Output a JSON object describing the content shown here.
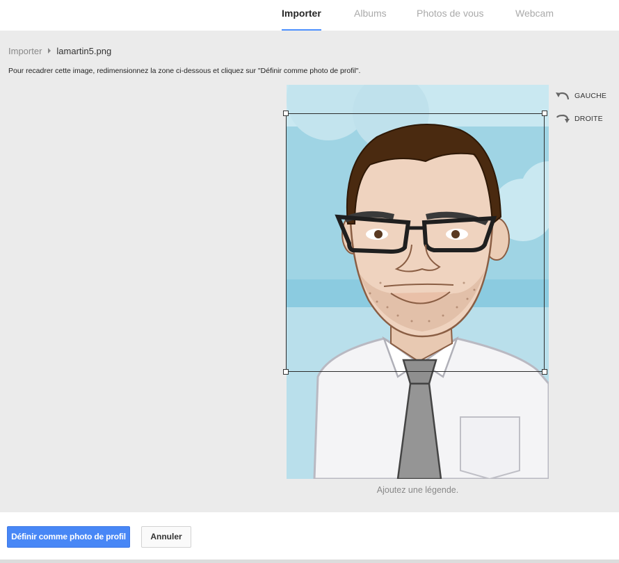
{
  "tabs": [
    {
      "label": "Importer",
      "active": true
    },
    {
      "label": "Albums",
      "active": false
    },
    {
      "label": "Photos de vous",
      "active": false
    },
    {
      "label": "Webcam",
      "active": false
    }
  ],
  "breadcrumb": {
    "root": "Importer",
    "current": "lamartin5.png"
  },
  "instructions": "Pour recadrer cette image, redimensionnez la zone ci-dessous et cliquez sur \"Définir comme photo de profil\".",
  "rotate": {
    "left_label": "GAUCHE",
    "right_label": "DROITE",
    "left_icon": "rotate-left-icon",
    "right_icon": "rotate-right-icon"
  },
  "caption_placeholder": "Ajoutez une légende.",
  "footer": {
    "primary_label": "Définir comme photo de profil",
    "cancel_label": "Annuler"
  },
  "colors": {
    "accent": "#4d90fe",
    "primary_button": "#4887f6",
    "page_background": "#ebebeb"
  }
}
